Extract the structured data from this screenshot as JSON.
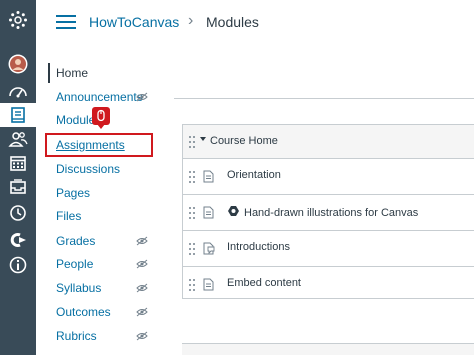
{
  "breadcrumb": {
    "course": "HowToCanvas",
    "separator": "›",
    "current": "Modules"
  },
  "global_nav": {
    "icons": [
      "canvas-logo-icon",
      "avatar",
      "dashboard-icon",
      "courses-icon",
      "groups-icon",
      "calendar-icon",
      "inbox-icon",
      "history-icon",
      "commons-icon",
      "help-icon"
    ]
  },
  "course_nav": {
    "items": [
      {
        "label": "Home",
        "hidden": false
      },
      {
        "label": "Announcements",
        "hidden": true
      },
      {
        "label": "Modules",
        "hidden": false
      },
      {
        "label": "Assignments",
        "hidden": false
      },
      {
        "label": "Discussions",
        "hidden": false
      },
      {
        "label": "Pages",
        "hidden": false
      },
      {
        "label": "Files",
        "hidden": false
      },
      {
        "label": "Grades",
        "hidden": true
      },
      {
        "label": "People",
        "hidden": true
      },
      {
        "label": "Syllabus",
        "hidden": true
      },
      {
        "label": "Outcomes",
        "hidden": true
      },
      {
        "label": "Rubrics",
        "hidden": true
      }
    ]
  },
  "module": {
    "title": "Course Home",
    "items": [
      {
        "title": "Orientation",
        "icon": "page-icon",
        "extra_icon": ""
      },
      {
        "title": "Hand-drawn illustrations for Canvas",
        "icon": "page-icon",
        "extra_icon": "canvas-badge-icon"
      },
      {
        "title": "Introductions",
        "icon": "discussion-icon",
        "extra_icon": ""
      },
      {
        "title": "Embed content",
        "icon": "page-icon",
        "extra_icon": ""
      }
    ]
  },
  "colors": {
    "global_nav_bg": "#394B58",
    "link": "#0770A3",
    "highlight": "#D0191E",
    "text": "#2D3B45"
  }
}
